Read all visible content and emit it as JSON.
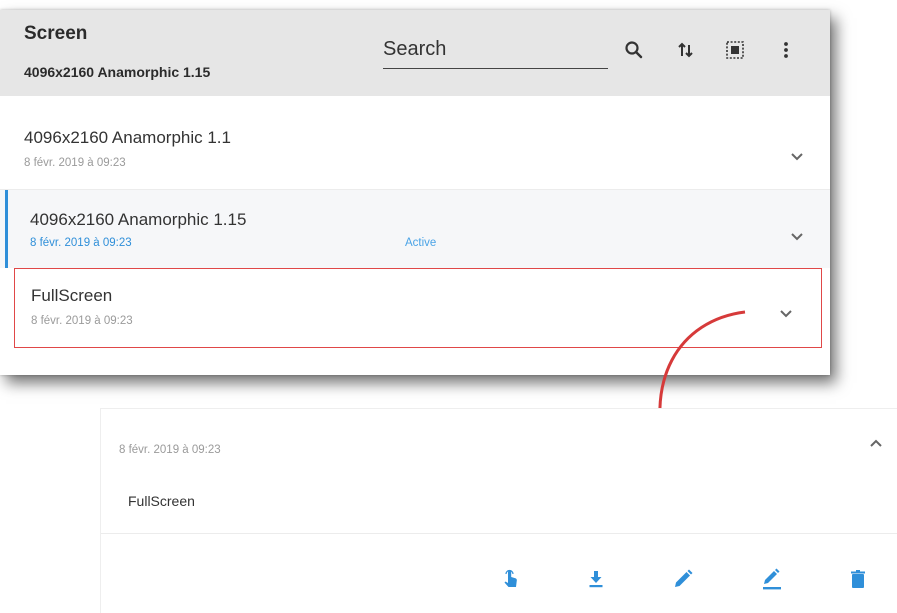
{
  "header": {
    "title": "Screen",
    "subtitle": "4096x2160 Anamorphic 1.15",
    "search_placeholder": "Search",
    "icons": [
      "search-icon",
      "sort-icon",
      "select-all-icon",
      "more-vert-icon"
    ]
  },
  "items": [
    {
      "name": "4096x2160 Anamorphic 1.1",
      "date": "8 févr. 2019 à 09:23",
      "status": ""
    },
    {
      "name": "4096x2160 Anamorphic 1.15",
      "date": "8 févr. 2019 à 09:23",
      "status": "Active"
    },
    {
      "name": "FullScreen",
      "date": "8 févr. 2019 à 09:23",
      "status": ""
    }
  ],
  "detail": {
    "date": "8 févr. 2019 à 09:23",
    "name": "FullScreen",
    "actions": [
      "touch-icon",
      "download-icon",
      "edit-icon",
      "rename-icon",
      "delete-icon"
    ]
  },
  "colors": {
    "accent": "#2f8fd9",
    "highlight": "#e04848",
    "header_bg": "#e6e6e6"
  }
}
